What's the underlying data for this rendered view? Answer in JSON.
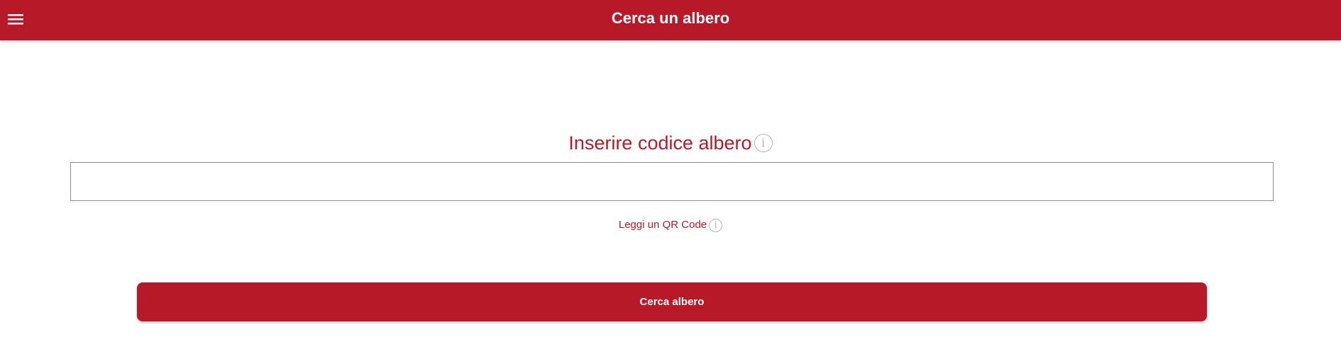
{
  "app_bar": {
    "title": "Cerca un albero",
    "menu_icon": "menu-icon",
    "background_color": "#b71928"
  },
  "form": {
    "code_label": "Inserire codice albero",
    "code_info_icon": "info-icon",
    "code_input_value": "",
    "code_input_placeholder": "",
    "qr_link_label": "Leggi un QR Code",
    "qr_info_icon": "info-icon",
    "submit_label": "Cerca albero"
  },
  "colors": {
    "accent": "#b71928",
    "info_icon": "#b5b5b5",
    "input_border": "#8c8c8c"
  }
}
